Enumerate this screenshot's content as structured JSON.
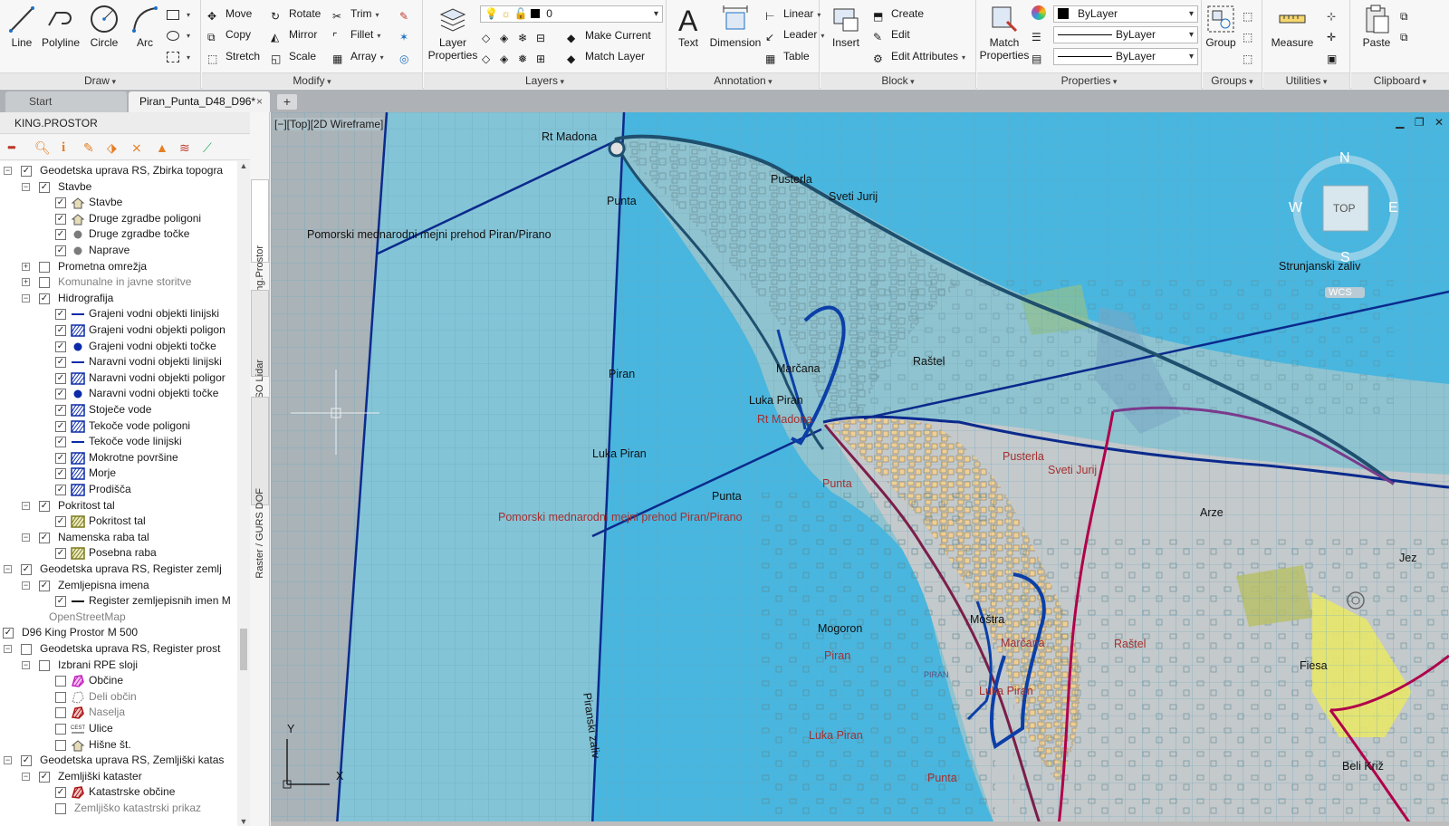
{
  "ribbon": {
    "draw": {
      "title": "Draw",
      "line": "Line",
      "polyline": "Polyline",
      "circle": "Circle",
      "arc": "Arc"
    },
    "modify": {
      "title": "Modify",
      "move": "Move",
      "rotate": "Rotate",
      "trim": "Trim",
      "copy": "Copy",
      "mirror": "Mirror",
      "fillet": "Fillet",
      "stretch": "Stretch",
      "scale": "Scale",
      "array": "Array"
    },
    "layers": {
      "title": "Layers",
      "layer_properties": "Layer Properties",
      "layer_combo": "0",
      "make_current": "Make Current",
      "match_layer": "Match Layer"
    },
    "annotation": {
      "title": "Annotation",
      "text": "Text",
      "dimension": "Dimension",
      "linear": "Linear",
      "leader": "Leader",
      "table": "Table"
    },
    "block": {
      "title": "Block",
      "insert": "Insert",
      "create": "Create",
      "edit": "Edit",
      "edit_attributes": "Edit Attributes"
    },
    "properties": {
      "title": "Properties",
      "match_properties": "Match Properties",
      "color": "ByLayer",
      "linetype": "ByLayer",
      "lineweight": "ByLayer"
    },
    "groups": {
      "title": "Groups",
      "group": "Group"
    },
    "utilities": {
      "title": "Utilities",
      "measure": "Measure"
    },
    "clipboard": {
      "title": "Clipboard",
      "paste": "Paste"
    }
  },
  "tabs": {
    "start": "Start",
    "drawing": "Piran_Punta_D48_D96*",
    "close": "×",
    "plus": "+"
  },
  "left_panel": {
    "title": "KING.PROSTOR",
    "vtabs": [
      "King.Prostor",
      "ARSO Lidar",
      "Raster / GURS DOF"
    ],
    "tree": [
      {
        "label": "Geodetska uprava RS, Zbirka topogra",
        "level": 2,
        "exp": "-",
        "checked": true,
        "legend": "none"
      },
      {
        "label": "Stavbe",
        "level": 3,
        "exp": "-",
        "checked": true,
        "legend": "none"
      },
      {
        "label": "Stavbe",
        "level": 4,
        "checked": true,
        "legend": "house"
      },
      {
        "label": "Druge zgradbe poligoni",
        "level": 4,
        "checked": true,
        "legend": "house"
      },
      {
        "label": "Druge zgradbe točke",
        "level": 4,
        "checked": true,
        "legend": "greydot"
      },
      {
        "label": "Naprave",
        "level": 4,
        "checked": true,
        "legend": "greydot"
      },
      {
        "label": "Prometna omrežja",
        "level": 3,
        "exp": "+",
        "checked": false,
        "legend": "none"
      },
      {
        "label": "Komunalne in javne storitve",
        "level": 3,
        "exp": "+",
        "checked": false,
        "legend": "none",
        "grey": true
      },
      {
        "label": "Hidrografija",
        "level": 3,
        "exp": "-",
        "checked": true,
        "legend": "none"
      },
      {
        "label": "Grajeni vodni objekti linijski",
        "level": 4,
        "checked": true,
        "legend": "blueline"
      },
      {
        "label": "Grajeni vodni objekti poligon",
        "level": 4,
        "checked": true,
        "legend": "hatch"
      },
      {
        "label": "Grajeni vodni objekti točke",
        "level": 4,
        "checked": true,
        "legend": "bluedot"
      },
      {
        "label": "Naravni vodni objekti linijski",
        "level": 4,
        "checked": true,
        "legend": "blueline"
      },
      {
        "label": "Naravni vodni objekti poligor",
        "level": 4,
        "checked": true,
        "legend": "hatch"
      },
      {
        "label": "Naravni vodni objekti točke",
        "level": 4,
        "checked": true,
        "legend": "bluedot"
      },
      {
        "label": "Stoječe vode",
        "level": 4,
        "checked": true,
        "legend": "hatch"
      },
      {
        "label": "Tekoče vode poligoni",
        "level": 4,
        "checked": true,
        "legend": "hatch"
      },
      {
        "label": "Tekoče vode linijski",
        "level": 4,
        "checked": true,
        "legend": "blueline"
      },
      {
        "label": "Mokrotne površine",
        "level": 4,
        "checked": true,
        "legend": "hatch"
      },
      {
        "label": "Morje",
        "level": 4,
        "checked": true,
        "legend": "hatch"
      },
      {
        "label": "Prodišča",
        "level": 4,
        "checked": true,
        "legend": "hatch"
      },
      {
        "label": "Pokritost tal",
        "level": 3,
        "exp": "-",
        "checked": true,
        "legend": "none"
      },
      {
        "label": "Pokritost tal",
        "level": 4,
        "checked": true,
        "legend": "olivehatch"
      },
      {
        "label": "Namenska raba tal",
        "level": 3,
        "exp": "-",
        "checked": true,
        "legend": "none"
      },
      {
        "label": "Posebna raba",
        "level": 4,
        "checked": true,
        "legend": "olivehatch"
      },
      {
        "label": "Geodetska uprava RS, Register zemlj",
        "level": 2,
        "exp": "-",
        "checked": true,
        "legend": "none"
      },
      {
        "label": "Zemljepisna imena",
        "level": 3,
        "exp": "-",
        "checked": true,
        "legend": "none"
      },
      {
        "label": "Register zemljepisnih imen M",
        "level": 4,
        "checked": true,
        "legend": "blackline"
      },
      {
        "label": "OpenStreetMap",
        "level": 1,
        "exp": "+",
        "checked": null,
        "legend": "none",
        "grey": true
      },
      {
        "label": "D96 King Prostor M 500",
        "level": 1,
        "exp": "-",
        "checked": true,
        "legend": "none"
      },
      {
        "label": "Geodetska uprava RS, Register prost",
        "level": 2,
        "exp": "-",
        "checked": false,
        "legend": "none"
      },
      {
        "label": "Izbrani RPE sloji",
        "level": 3,
        "exp": "-",
        "checked": false,
        "legend": "none"
      },
      {
        "label": "Občine",
        "level": 4,
        "checked": false,
        "legend": "magentahatch"
      },
      {
        "label": "Deli občin",
        "level": 4,
        "checked": false,
        "legend": "outlinegrey",
        "grey": true
      },
      {
        "label": "Naselja",
        "level": 4,
        "checked": false,
        "legend": "redhatch",
        "grey": true
      },
      {
        "label": "Ulice",
        "level": 4,
        "checked": false,
        "legend": "cest"
      },
      {
        "label": "Hišne št.",
        "level": 4,
        "checked": false,
        "legend": "house"
      },
      {
        "label": "Geodetska uprava RS, Zemljiški katas",
        "level": 2,
        "exp": "-",
        "checked": true,
        "legend": "none"
      },
      {
        "label": "Zemljiški kataster",
        "level": 3,
        "exp": "-",
        "checked": true,
        "legend": "none"
      },
      {
        "label": "Katastrske občine",
        "level": 4,
        "checked": true,
        "legend": "redhatch"
      },
      {
        "label": "Zemljiško katastrski prikaz",
        "level": 4,
        "checked": false,
        "legend": "none",
        "grey": true
      }
    ]
  },
  "viewport": {
    "control": "[−][Top][2D Wireframe]",
    "win_controls": [
      "▁",
      "❐",
      "✕"
    ],
    "viewcube": {
      "n": "N",
      "s": "S",
      "e": "E",
      "w": "W",
      "top": "TOP",
      "wcs": "WCS"
    },
    "axis": {
      "x": "X",
      "y": "Y"
    }
  },
  "map_labels": [
    {
      "text": "Rt Madona",
      "kind": "blk",
      "id": "rt-madona-1"
    },
    {
      "text": "Punta",
      "kind": "blk",
      "id": "punta-1"
    },
    {
      "text": "Pusterla",
      "kind": "blk",
      "id": "pusterla-1"
    },
    {
      "text": "Sveti Jurij",
      "kind": "blk",
      "id": "sveti-jurij-1"
    },
    {
      "text": "Pomorski mednarodni mejni prehod Piran/Pirano",
      "kind": "blk",
      "id": "pomorski-1"
    },
    {
      "text": "Strunjanski zaliv",
      "kind": "blk",
      "id": "strunjanski"
    },
    {
      "text": "Piran",
      "kind": "blk",
      "id": "piran-1"
    },
    {
      "text": "Marčana",
      "kind": "blk",
      "id": "marcana-1"
    },
    {
      "text": "Raštel",
      "kind": "blk",
      "id": "rastel-1"
    },
    {
      "text": "Luka Piran",
      "kind": "blk",
      "id": "luka-piran-1"
    },
    {
      "text": "Rt Madona",
      "kind": "red",
      "id": "rt-madona-2"
    },
    {
      "text": "Luka Piran",
      "kind": "blk",
      "id": "luka-piran-2"
    },
    {
      "text": "Pusterla",
      "kind": "red",
      "id": "pusterla-2"
    },
    {
      "text": "Sveti Jurij",
      "kind": "red",
      "id": "sveti-jurij-2"
    },
    {
      "text": "Punta",
      "kind": "red",
      "id": "punta-2"
    },
    {
      "text": "Punta",
      "kind": "blk",
      "id": "punta-3"
    },
    {
      "text": "Pomorski mednarodni mejni prehod Piran/Pirano",
      "kind": "red",
      "id": "pomorski-2"
    },
    {
      "text": "Arze",
      "kind": "blk",
      "id": "arze"
    },
    {
      "text": "Jez",
      "kind": "blk",
      "id": "jez"
    },
    {
      "text": "Moštra",
      "kind": "blk",
      "id": "mostra"
    },
    {
      "text": "Marčana",
      "kind": "red",
      "id": "marcana-2"
    },
    {
      "text": "Raštel",
      "kind": "red",
      "id": "rastel-2"
    },
    {
      "text": "Mogoron",
      "kind": "blk",
      "id": "mogoron"
    },
    {
      "text": "Piran",
      "kind": "red",
      "id": "piran-2"
    },
    {
      "text": "PIRAN",
      "kind": "red",
      "id": "piran-caps"
    },
    {
      "text": "Fiesa",
      "kind": "blk",
      "id": "fiesa"
    },
    {
      "text": "Luka Piran",
      "kind": "red",
      "id": "luka-piran-3"
    },
    {
      "text": "Luka Piran",
      "kind": "red",
      "id": "luka-piran-4"
    },
    {
      "text": "Piranski zaliv",
      "kind": "blk",
      "id": "piranski-zaliv"
    },
    {
      "text": "Punta",
      "kind": "red",
      "id": "punta-4"
    },
    {
      "text": "Beli Križ",
      "kind": "blk",
      "id": "beli-kriz"
    }
  ],
  "colors": {
    "sea": "#48b6df",
    "land": "#8fc7d6",
    "coastline": "#1f4f6e",
    "boundary": "#0b2a8c",
    "road": "#b0004a",
    "town": "#f3d9a8"
  }
}
